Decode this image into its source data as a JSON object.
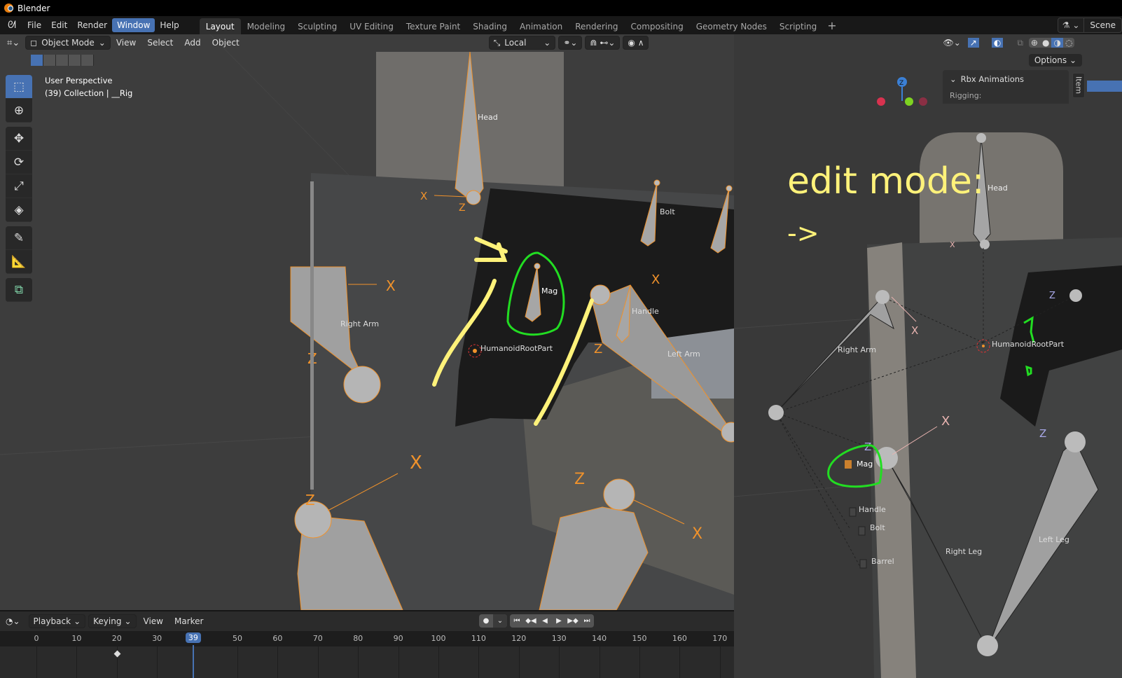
{
  "window": {
    "title": "Blender"
  },
  "menu": {
    "items": [
      "File",
      "Edit",
      "Render",
      "Window",
      "Help"
    ],
    "active": "Window"
  },
  "workspaces": {
    "tabs": [
      "Layout",
      "Modeling",
      "Sculpting",
      "UV Editing",
      "Texture Paint",
      "Shading",
      "Animation",
      "Rendering",
      "Compositing",
      "Geometry Nodes",
      "Scripting"
    ],
    "active": "Layout",
    "add": "+"
  },
  "scene": {
    "label": "Scene"
  },
  "viewport": {
    "mode": "Object Mode",
    "menu": [
      "View",
      "Select",
      "Add",
      "Object"
    ],
    "transform_orientation": "Local",
    "overlay_line1": "User Perspective",
    "overlay_line2": "(39) Collection | __Rig",
    "options_label": "Options",
    "accent": "#4772b3"
  },
  "npanel": {
    "header": "Rbx Animations",
    "subheader": "Rigging:",
    "tab": "Item"
  },
  "tools": [
    "select-box",
    "cursor",
    "move",
    "rotate",
    "scale",
    "transform",
    "annotate",
    "measure",
    "add-cube"
  ],
  "scene_left": {
    "bones": [
      "Head",
      "Right Arm",
      "Mag",
      "Handle",
      "Bolt",
      "Left Arm",
      "HumanoidRootPart"
    ],
    "axis": {
      "x": "X",
      "z": "Z"
    },
    "bone_color": "#f0922b",
    "annotation_yellow": "#fff27a",
    "annotation_green": "#22dd22"
  },
  "scene_right": {
    "annotation": "edit mode:",
    "arrow": "->",
    "bones": [
      "Head",
      "Right Arm",
      "HumanoidRootPart",
      "Mag",
      "Handle",
      "Bolt",
      "Barrel",
      "Right Leg",
      "Left Leg"
    ]
  },
  "timeline": {
    "menu": [
      "Playback",
      "Keying",
      "View",
      "Marker"
    ],
    "ticks": [
      "0",
      "10",
      "20",
      "30",
      "39",
      "50",
      "60",
      "70",
      "80",
      "90",
      "100",
      "110",
      "120",
      "130",
      "140",
      "150",
      "160",
      "170"
    ],
    "current_frame": "39",
    "keyframe_at": 20
  }
}
